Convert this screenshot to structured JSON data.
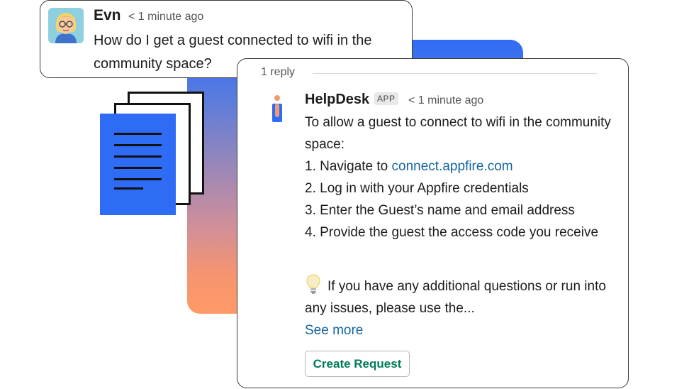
{
  "colors": {
    "accent_blue": "#2f6cf6",
    "gradient_end": "#ff9a66",
    "link": "#1264a3",
    "button_text": "#007a5a"
  },
  "original_message": {
    "author": "Evn",
    "timestamp": "< 1 minute ago",
    "text": "How do I get a guest connected to wifi in the community space?",
    "avatar_icon": "user-avatar-cartoon"
  },
  "thread": {
    "reply_count": "1 reply",
    "reply": {
      "bot_name": "HelpDesk",
      "badge": "APP",
      "timestamp": "< 1 minute ago",
      "bot_icon": "helpdesk-bot-icon",
      "intro": "To allow a guest to connect to wifi in the community space:",
      "steps": [
        {
          "prefix": "1. Navigate to ",
          "link": "connect.appfire.com"
        },
        {
          "text": "2. Log in with your Appfire credentials"
        },
        {
          "text": "3. Enter the Guest’s name and email address"
        },
        {
          "text": "4. Provide the guest the access code you receive"
        }
      ],
      "tip_icon": "lightbulb-icon",
      "tip_text": "If you have any additional questions or run into any issues, please use the...",
      "see_more": "See more",
      "button_label": "Create Request"
    }
  },
  "illustration": {
    "icon": "document-stack-icon"
  }
}
